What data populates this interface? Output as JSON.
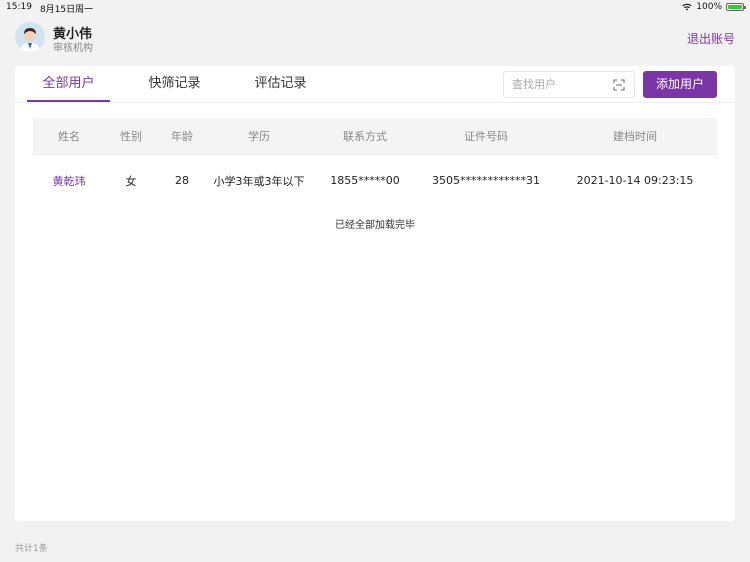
{
  "status_bar": {
    "time": "15:19",
    "date": "8月15日周一",
    "battery": "100%"
  },
  "header": {
    "user_name": "黄小伟",
    "org": "审核机构",
    "logout_label": "退出账号"
  },
  "tabs": [
    {
      "label": "全部用户",
      "active": true
    },
    {
      "label": "快筛记录",
      "active": false
    },
    {
      "label": "评估记录",
      "active": false
    }
  ],
  "search": {
    "placeholder": "查找用户"
  },
  "add_button_label": "添加用户",
  "table": {
    "columns": [
      "姓名",
      "性别",
      "年龄",
      "学历",
      "联系方式",
      "证件号码",
      "建档时间"
    ],
    "rows": [
      [
        "黄乾玮",
        "女",
        "28",
        "小学3年或3年以下",
        "1855*****00",
        "3505************31",
        "2021-10-14 09:23:15"
      ]
    ]
  },
  "loaded_text": "已经全部加载完毕",
  "footer_count": "共计1条",
  "colors": {
    "accent": "#7a35a6"
  }
}
